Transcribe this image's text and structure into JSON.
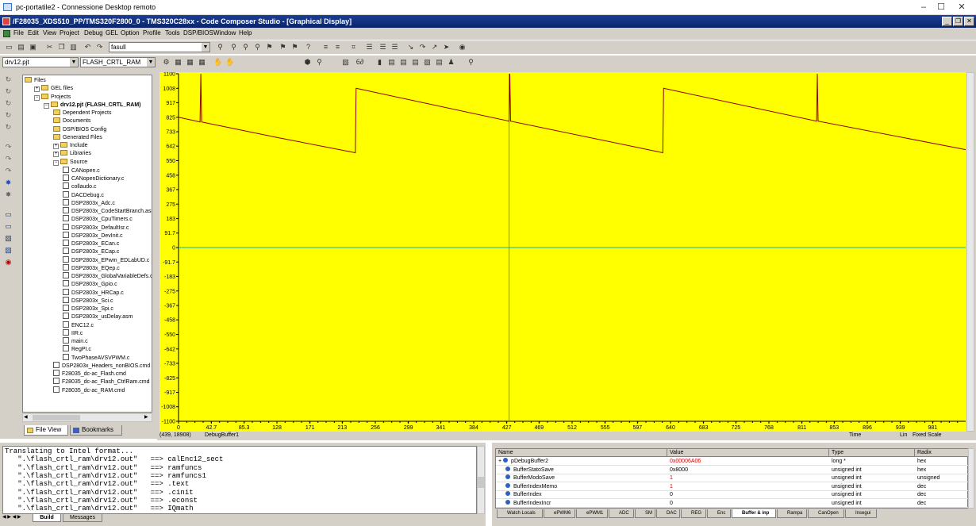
{
  "rdp": {
    "title": "pc-portatile2 - Connessione Desktop remoto"
  },
  "ccs": {
    "title": "/F28035_XDS510_PP/TMS320F2800_0 - TMS320C28xx - Code Composer Studio - [Graphical Display]"
  },
  "menu": [
    "File",
    "Edit",
    "View",
    "Project",
    "Debug",
    "GEL",
    "Option",
    "Profile",
    "Tools",
    "DSP/BIOS",
    "Window",
    "Help"
  ],
  "toolbar": {
    "search_value": "fasull",
    "project_select": "drv12.pjt",
    "config_select": "FLASH_CRTL_RAM"
  },
  "tree": {
    "items": [
      {
        "label": "Files",
        "indent": 0,
        "kind": "root"
      },
      {
        "label": "GEL files",
        "indent": 1,
        "kind": "folder"
      },
      {
        "label": "Projects",
        "indent": 1,
        "kind": "folder"
      },
      {
        "label": "drv12.pjt (FLASH_CRTL_RAM)",
        "indent": 2,
        "kind": "project"
      },
      {
        "label": "Dependent Projects",
        "indent": 3,
        "kind": "folder"
      },
      {
        "label": "Documents",
        "indent": 3,
        "kind": "folder"
      },
      {
        "label": "DSP/BIOS Config",
        "indent": 3,
        "kind": "folder"
      },
      {
        "label": "Generated Files",
        "indent": 3,
        "kind": "folder"
      },
      {
        "label": "Include",
        "indent": 3,
        "kind": "folder"
      },
      {
        "label": "Libraries",
        "indent": 3,
        "kind": "folder"
      },
      {
        "label": "Source",
        "indent": 3,
        "kind": "folder"
      },
      {
        "label": "CANopen.c",
        "indent": 4,
        "kind": "file"
      },
      {
        "label": "CANopenDictionary.c",
        "indent": 4,
        "kind": "file"
      },
      {
        "label": "collaudo.c",
        "indent": 4,
        "kind": "file"
      },
      {
        "label": "DACDebug.c",
        "indent": 4,
        "kind": "file"
      },
      {
        "label": "DSP2803x_Adc.c",
        "indent": 4,
        "kind": "file"
      },
      {
        "label": "DSP2803x_CodeStartBranch.asm",
        "indent": 4,
        "kind": "file"
      },
      {
        "label": "DSP2803x_CpuTimers.c",
        "indent": 4,
        "kind": "file"
      },
      {
        "label": "DSP2803x_DefaultIsr.c",
        "indent": 4,
        "kind": "file"
      },
      {
        "label": "DSP2803x_DevInit.c",
        "indent": 4,
        "kind": "file"
      },
      {
        "label": "DSP2803x_ECan.c",
        "indent": 4,
        "kind": "file"
      },
      {
        "label": "DSP2803x_ECap.c",
        "indent": 4,
        "kind": "file"
      },
      {
        "label": "DSP2803x_EPwm_EDLabUD.c",
        "indent": 4,
        "kind": "file"
      },
      {
        "label": "DSP2803x_EQep.c",
        "indent": 4,
        "kind": "file"
      },
      {
        "label": "DSP2803x_GlobalVariableDefs.c",
        "indent": 4,
        "kind": "file"
      },
      {
        "label": "DSP2803x_Gpio.c",
        "indent": 4,
        "kind": "file"
      },
      {
        "label": "DSP2803x_HRCap.c",
        "indent": 4,
        "kind": "file"
      },
      {
        "label": "DSP2803x_Sci.c",
        "indent": 4,
        "kind": "file"
      },
      {
        "label": "DSP2803x_Spi.c",
        "indent": 4,
        "kind": "file"
      },
      {
        "label": "DSP2803x_usDelay.asm",
        "indent": 4,
        "kind": "file"
      },
      {
        "label": "ENC12.c",
        "indent": 4,
        "kind": "file"
      },
      {
        "label": "IIR.c",
        "indent": 4,
        "kind": "file"
      },
      {
        "label": "main.c",
        "indent": 4,
        "kind": "file"
      },
      {
        "label": "RegPI.c",
        "indent": 4,
        "kind": "file"
      },
      {
        "label": "TwoPhaseAVSVPWM.c",
        "indent": 4,
        "kind": "file"
      },
      {
        "label": "DSP2803x_Headers_nonBIOS.cmd",
        "indent": 3,
        "kind": "file"
      },
      {
        "label": "F28035_dc-ac_Flash.cmd",
        "indent": 3,
        "kind": "file"
      },
      {
        "label": "F28035_dc-ac_Flash_CtrlRam.cmd",
        "indent": 3,
        "kind": "file"
      },
      {
        "label": "F28035_dc-ac_RAM.cmd",
        "indent": 3,
        "kind": "file"
      }
    ],
    "tab_file_view": "File View",
    "tab_bookmarks": "Bookmarks"
  },
  "graph": {
    "cursor_readout": "(439, 18908)",
    "display_name": "DebugBuffer1",
    "time_label": "Time",
    "scale_lin": "Lin",
    "scale_fixed": "Fixed Scale",
    "background": "#ffff00",
    "trace_color": "#8b0000",
    "grid_color": "#00b8b8"
  },
  "chart_data": {
    "type": "line",
    "xlim": [
      0,
      1024
    ],
    "ylim": [
      -1100,
      1100
    ],
    "x_ticks": [
      "0",
      "42.7",
      "85.3",
      "128",
      "171",
      "213",
      "256",
      "299",
      "341",
      "384",
      "427",
      "469",
      "512",
      "555",
      "597",
      "640",
      "683",
      "725",
      "768",
      "811",
      "853",
      "896",
      "939",
      "981"
    ],
    "y_ticks": [
      "1100",
      "1008",
      "917",
      "825",
      "733",
      "642",
      "550",
      "458",
      "367",
      "275",
      "183",
      "91.7",
      "0",
      "-91.7",
      "-183",
      "-275",
      "-367",
      "-458",
      "-550",
      "-642",
      "-733",
      "-825",
      "-917",
      "-1008",
      "-1100"
    ],
    "cursor_x": 430,
    "series": [
      {
        "points": [
          [
            0,
            825
          ],
          [
            28,
            795
          ],
          [
            29,
            1100
          ],
          [
            30,
            795
          ],
          [
            130,
            695
          ],
          [
            230,
            600
          ],
          [
            231,
            1008
          ],
          [
            430,
            800
          ],
          [
            431,
            1100
          ],
          [
            432,
            800
          ],
          [
            630,
            600
          ],
          [
            631,
            1008
          ],
          [
            830,
            800
          ],
          [
            831,
            1100
          ],
          [
            832,
            800
          ],
          [
            1024,
            620
          ]
        ]
      }
    ]
  },
  "build": {
    "lines": [
      "Translating to Intel format...",
      "   \".\\flash_crtl_ram\\drv12.out\"   ==> calEnc12_sect",
      "   \".\\flash_crtl_ram\\drv12.out\"   ==> ramfuncs",
      "   \".\\flash_crtl_ram\\drv12.out\"   ==> ramfuncs1",
      "   \".\\flash_crtl_ram\\drv12.out\"   ==> .text",
      "   \".\\flash_crtl_ram\\drv12.out\"   ==> .cinit",
      "   \".\\flash_crtl_ram\\drv12.out\"   ==> .econst",
      "   \".\\flash_crtl_ram\\drv12.out\"   ==> IQmath"
    ],
    "tabs": [
      "Build",
      "Messages"
    ]
  },
  "watch": {
    "headers": [
      "Name",
      "Value",
      "Type",
      "Radix"
    ],
    "rows": [
      {
        "name": "pDebugBuffer2",
        "value": "0x00006A06",
        "type": "long *",
        "radix": "hex",
        "red": true
      },
      {
        "name": "BufferStatoSave",
        "value": "0x8000",
        "type": "unsigned int",
        "radix": "hex",
        "red": false
      },
      {
        "name": "BufferModoSave",
        "value": "1",
        "type": "unsigned int",
        "radix": "unsigned",
        "red": true
      },
      {
        "name": "BufferIndexMemo",
        "value": "1",
        "type": "unsigned int",
        "radix": "dec",
        "red": true
      },
      {
        "name": "BufferIndex",
        "value": "0",
        "type": "unsigned int",
        "radix": "dec",
        "red": false
      },
      {
        "name": "BufferIndexIncr",
        "value": "0",
        "type": "unsigned int",
        "radix": "dec",
        "red": false
      }
    ],
    "tabs": [
      "Watch Locals",
      "ePWM6",
      "ePWM1",
      "ADC",
      "SM",
      "DAC",
      "REG",
      "Enc",
      "Buffer & inp",
      "Rampa",
      "CanOpen",
      "Insegui"
    ]
  }
}
